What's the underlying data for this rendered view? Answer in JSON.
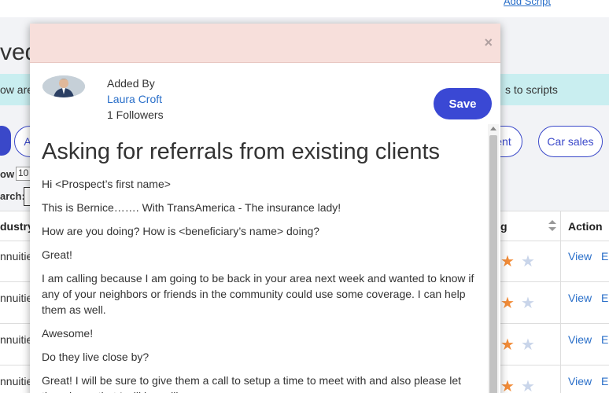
{
  "background": {
    "add_script": "Add Script",
    "title_fragment": "ved",
    "banner_left": "ow are",
    "banner_right": "s to scripts",
    "pills": [
      "A",
      "ent",
      "Car sales"
    ],
    "show_label": "ow",
    "show_value": "10",
    "search_label": "arch:",
    "columns": {
      "industry": "dustry",
      "rating": "g",
      "action": "Action"
    },
    "rows": [
      {
        "industry": "nnuitie",
        "view": "View",
        "edit": "E",
        "rating": 4
      },
      {
        "industry": "nnuitie",
        "view": "View",
        "edit": "E",
        "rating": 4
      },
      {
        "industry": "nnuitie",
        "view": "View",
        "edit": "E",
        "rating": 4
      },
      {
        "industry": "nnuitie",
        "view": "View",
        "edit": "E",
        "rating": 4
      }
    ]
  },
  "modal": {
    "close_label": "×",
    "added_by_label": "Added By",
    "author_name": "Laura Croft",
    "followers": "1 Followers",
    "save_label": "Save",
    "title": "Asking for referrals from existing clients",
    "paragraphs": [
      "Hi <Prospect’s first name>",
      "This is Bernice……. With TransAmerica - The  insurance lady!",
      "How are you doing? How is <beneficiary’s name> doing?",
      "Great!",
      "I am calling because I am going to be back in your area next week and wanted to know if any of your neighbors or friends in the community could use some coverage. I can help them as well.",
      "Awesome!",
      "Do they live close by?",
      "Great! I will be sure to give them a call to setup a time to meet with and also please let them know that I will be calling."
    ]
  },
  "colors": {
    "accent": "#3a48d4",
    "header_bg": "#f7dfdb",
    "link": "#2a6fc9",
    "star_on": "#f28c38",
    "star_off": "#c9d5ea"
  }
}
